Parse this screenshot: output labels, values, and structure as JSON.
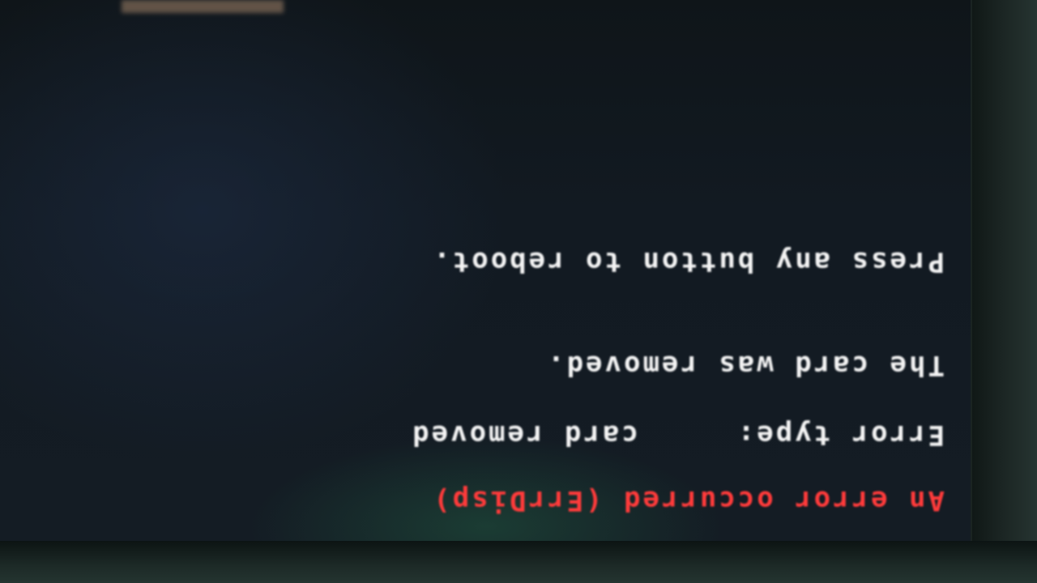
{
  "error_screen": {
    "title": "An error occurred (ErrDisp)",
    "type_label": "Error type:",
    "type_value": "card removed",
    "message": "The card was removed.",
    "prompt": "Press any button to reboot."
  },
  "colors": {
    "title_text": "#ff3b3b",
    "body_text": "#f4f4f4",
    "screen_background": "#121a22"
  }
}
